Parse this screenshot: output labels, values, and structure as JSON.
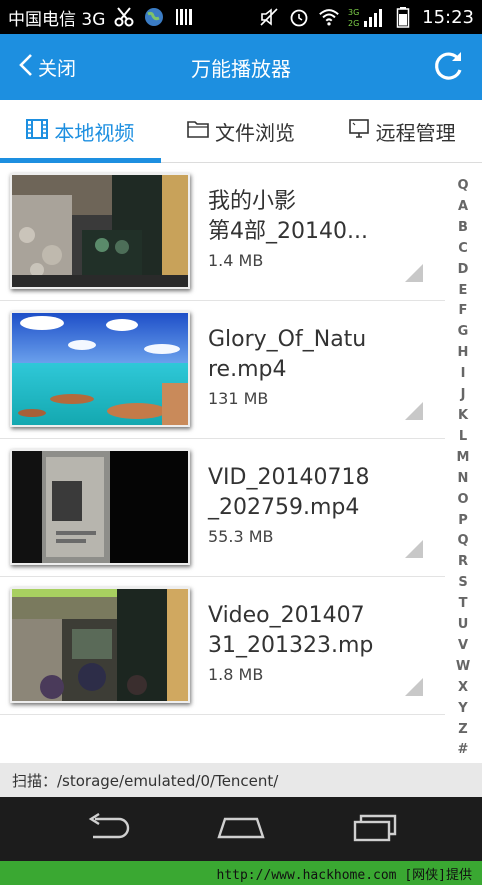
{
  "status_bar": {
    "carrier": "中国电信 3G",
    "time": "15:23",
    "icons": [
      "scissors-icon",
      "globe-icon",
      "barcode-icon",
      "mute-icon",
      "alarm-icon",
      "wifi-icon",
      "signal-icon",
      "battery-icon"
    ],
    "network_badge_top": "3G",
    "network_badge_bottom": "2G"
  },
  "header": {
    "back_label": "关闭",
    "title": "万能播放器",
    "refresh_icon": "refresh-icon",
    "accent": "#1d8fe0"
  },
  "tabs": [
    {
      "label": "本地视频",
      "icon": "film-icon",
      "active": true
    },
    {
      "label": "文件浏览",
      "icon": "folder-icon",
      "active": false
    },
    {
      "label": "远程管理",
      "icon": "monitor-icon",
      "active": false
    }
  ],
  "videos": [
    {
      "name": "我的小影\n第4部_20140...",
      "size": "1.4 MB",
      "thumb": "party-scene"
    },
    {
      "name": "Glory_Of_Natu\nre.mp4",
      "size": "131 MB",
      "thumb": "ocean-scene"
    },
    {
      "name": "VID_20140718\n_202759.mp4",
      "size": "55.3 MB",
      "thumb": "dark-poster-scene"
    },
    {
      "name": "Video_201407\n31_201323.mp",
      "size": "1.8 MB",
      "thumb": "party-scene-2"
    }
  ],
  "alphabet": [
    "Q",
    "A",
    "B",
    "C",
    "D",
    "E",
    "F",
    "G",
    "H",
    "I",
    "J",
    "K",
    "L",
    "M",
    "N",
    "O",
    "P",
    "Q",
    "R",
    "S",
    "T",
    "U",
    "V",
    "W",
    "X",
    "Y",
    "Z",
    "#"
  ],
  "scan_text": "扫描：/storage/emulated/0/Tencent/",
  "nav": [
    "back-icon",
    "home-icon",
    "recent-apps-icon"
  ],
  "watermark": "http://www.hackhome.com [网侠]提供"
}
